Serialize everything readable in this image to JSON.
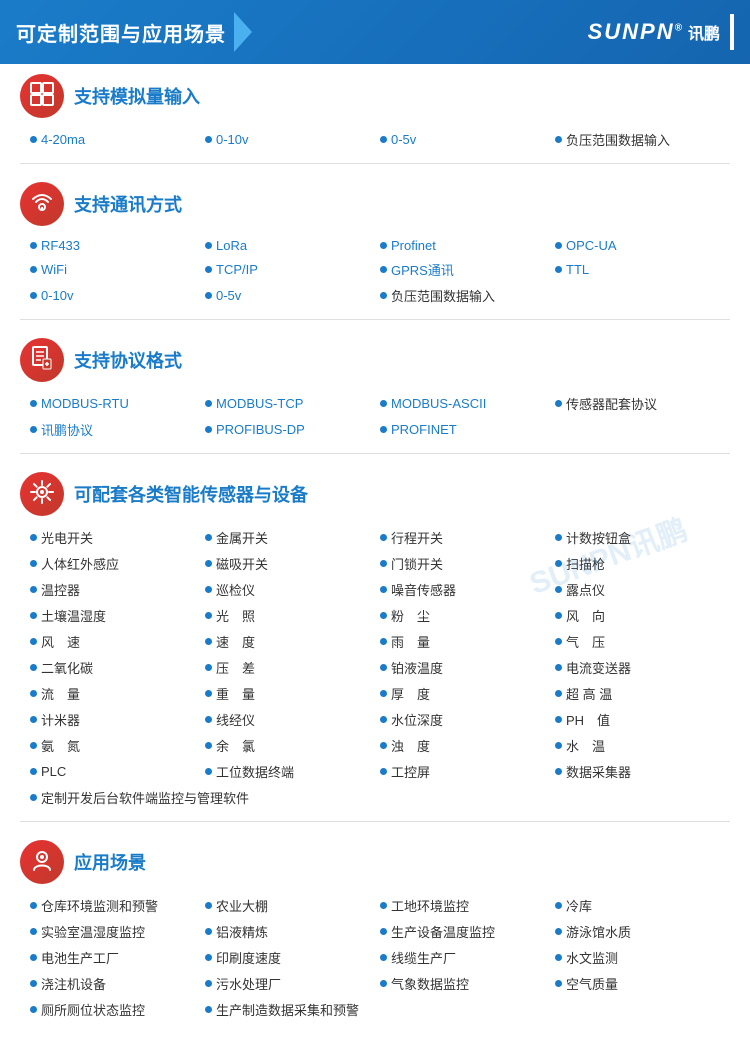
{
  "header": {
    "title": "可定制范围与应用场景",
    "logo_text": "SUNPN",
    "logo_reg": "®",
    "logo_cn": "讯鹏",
    "logo_bar": "|"
  },
  "sections": [
    {
      "id": "analog",
      "title": "支持模拟量输入",
      "icon": "⊞",
      "items": [
        {
          "text": "4-20ma",
          "blue": true
        },
        {
          "text": "0-10v",
          "blue": true
        },
        {
          "text": "0-5v",
          "blue": true
        },
        {
          "text": "负压范围数据输入",
          "blue": false
        }
      ],
      "cols": 4
    },
    {
      "id": "comm",
      "title": "支持通讯方式",
      "icon": "📡",
      "rows": [
        [
          {
            "text": "RF433",
            "blue": true
          },
          {
            "text": "LoRa",
            "blue": true
          },
          {
            "text": "Profinet",
            "blue": true
          },
          {
            "text": "OPC-UA",
            "blue": true
          }
        ],
        [
          {
            "text": "WiFi",
            "blue": true
          },
          {
            "text": "TCP/IP",
            "blue": true
          },
          {
            "text": "GPRS通讯",
            "blue": true
          },
          {
            "text": "TTL",
            "blue": true
          }
        ],
        [
          {
            "text": "0-10v",
            "blue": true
          },
          {
            "text": "0-5v",
            "blue": true
          },
          {
            "text": "负压范围数据输入",
            "blue": false
          },
          {
            "text": "",
            "blue": false
          }
        ]
      ]
    },
    {
      "id": "protocol",
      "title": "支持协议格式",
      "icon": "📋",
      "rows": [
        [
          {
            "text": "MODBUS-RTU",
            "blue": true
          },
          {
            "text": "MODBUS-TCP",
            "blue": true
          },
          {
            "text": "MODBUS-ASCII",
            "blue": true
          },
          {
            "text": "传感器配套协议",
            "blue": false
          }
        ],
        [
          {
            "text": "讯鹏协议",
            "blue": true
          },
          {
            "text": "PROFIBUS-DP",
            "blue": true
          },
          {
            "text": "PROFINET",
            "blue": true
          },
          {
            "text": "",
            "blue": false
          }
        ]
      ]
    },
    {
      "id": "sensors",
      "title": "可配套各类智能传感器与设备",
      "icon": "⚙",
      "rows": [
        [
          {
            "text": "光电开关"
          },
          {
            "text": "金属开关"
          },
          {
            "text": "行程开关"
          },
          {
            "text": "计数按钮盒"
          }
        ],
        [
          {
            "text": "人体红外感应"
          },
          {
            "text": "磁吸开关"
          },
          {
            "text": "门锁开关"
          },
          {
            "text": "扫描枪"
          }
        ],
        [
          {
            "text": "温控器"
          },
          {
            "text": "巡检仪"
          },
          {
            "text": "噪音传感器"
          },
          {
            "text": "露点仪"
          }
        ],
        [
          {
            "text": "土壤温湿度"
          },
          {
            "text": "光  照"
          },
          {
            "text": "粉  尘"
          },
          {
            "text": "风  向"
          }
        ],
        [
          {
            "text": "风  速"
          },
          {
            "text": "速  度"
          },
          {
            "text": "雨  量"
          },
          {
            "text": "气  压"
          }
        ],
        [
          {
            "text": "二氧化碳"
          },
          {
            "text": "压  差"
          },
          {
            "text": "铂液温度"
          },
          {
            "text": "电流变送器"
          }
        ],
        [
          {
            "text": "流  量"
          },
          {
            "text": "重  量"
          },
          {
            "text": "厚  度"
          },
          {
            "text": "超 高 温"
          }
        ],
        [
          {
            "text": "计米器"
          },
          {
            "text": "线经仪"
          },
          {
            "text": "水位深度"
          },
          {
            "text": "PH  值"
          }
        ],
        [
          {
            "text": "氨  氮"
          },
          {
            "text": "余  氯"
          },
          {
            "text": "浊  度"
          },
          {
            "text": "水  温"
          }
        ],
        [
          {
            "text": "PLC"
          },
          {
            "text": "工位数据终端"
          },
          {
            "text": "工控屏"
          },
          {
            "text": "数据采集器"
          }
        ],
        [
          {
            "text": "定制开发后台软件端监控与管理软件",
            "full": true
          }
        ]
      ]
    },
    {
      "id": "application",
      "title": "应用场景",
      "icon": "🏭",
      "rows": [
        [
          {
            "text": "仓库环境监测和预警"
          },
          {
            "text": "农业大棚"
          },
          {
            "text": "工地环境监控"
          },
          {
            "text": "冷库"
          }
        ],
        [
          {
            "text": "实验室温湿度监控"
          },
          {
            "text": "铝液精炼"
          },
          {
            "text": "生产设备温度监控"
          },
          {
            "text": "游泳馆水质"
          }
        ],
        [
          {
            "text": "电池生产工厂"
          },
          {
            "text": "印刷度速度"
          },
          {
            "text": "线缆生产厂"
          },
          {
            "text": "水文监测"
          }
        ],
        [
          {
            "text": "浇注机设备"
          },
          {
            "text": "污水处理厂"
          },
          {
            "text": "气象数据监控"
          },
          {
            "text": "空气质量"
          }
        ],
        [
          {
            "text": "厕所厕位状态监控"
          },
          {
            "text": "生产制造数据采集和预警",
            "span": true
          },
          {
            "text": ""
          },
          {
            "text": ""
          }
        ]
      ]
    }
  ]
}
